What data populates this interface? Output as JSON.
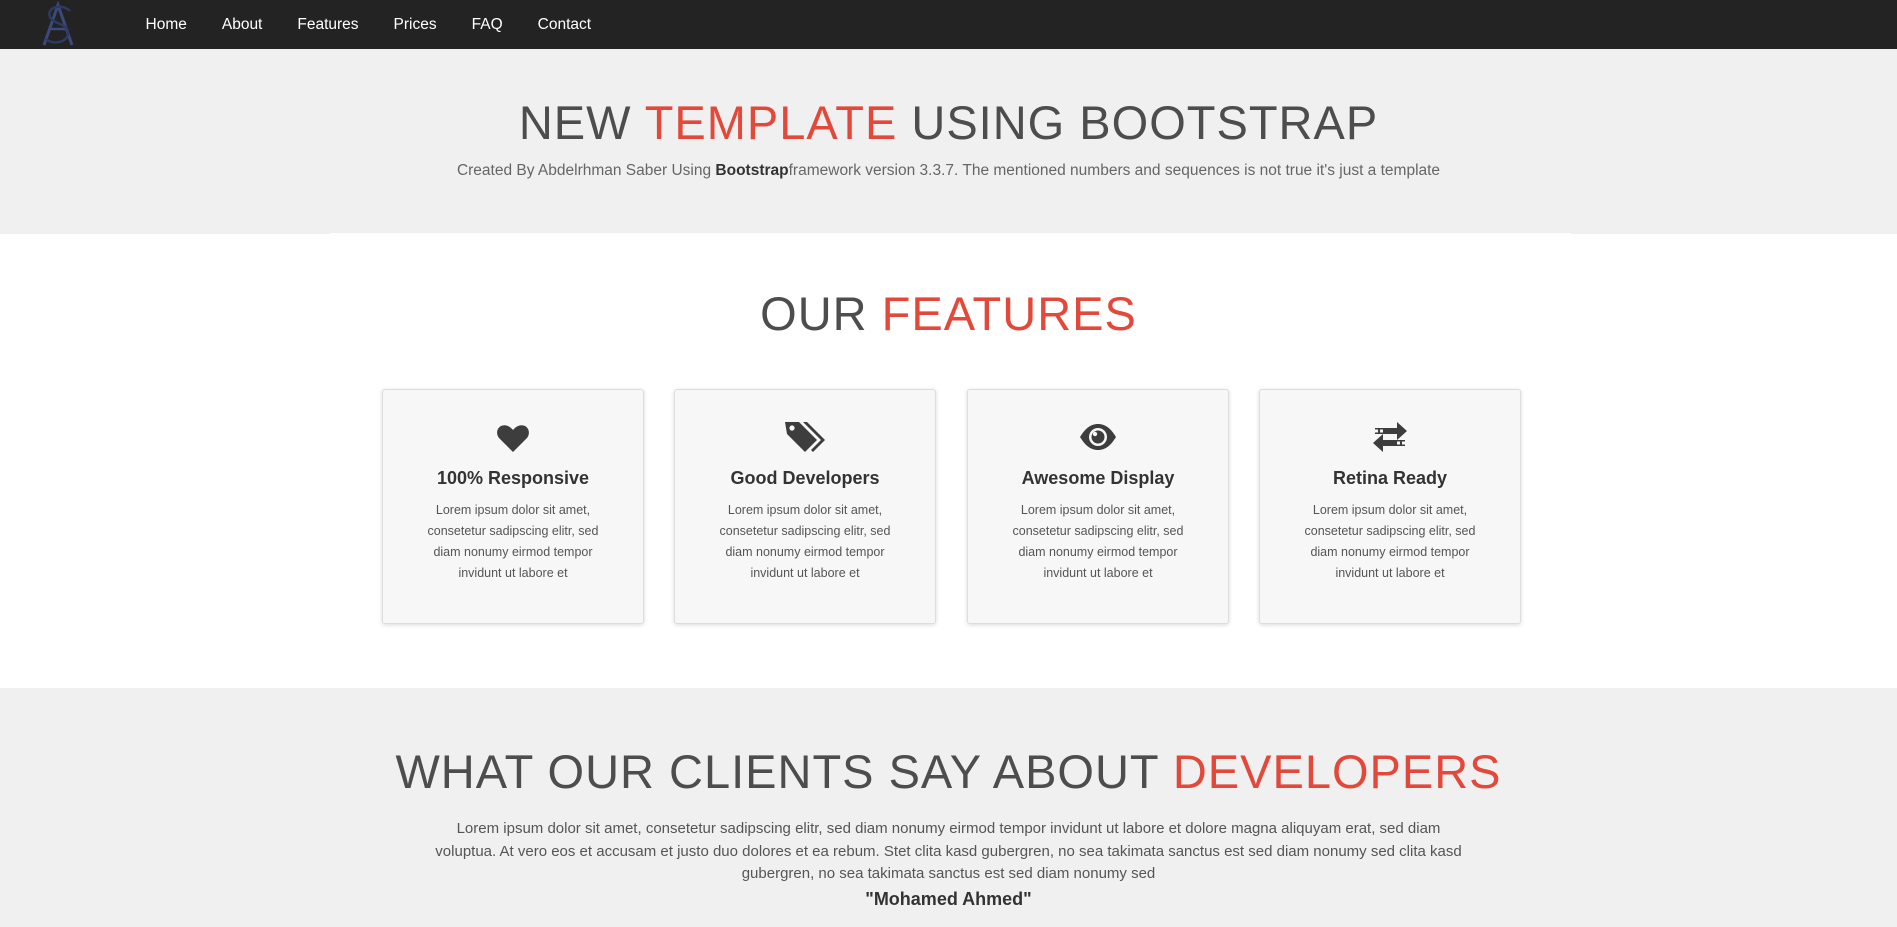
{
  "nav": {
    "logo_alt": "AS logo",
    "links": [
      "Home",
      "About",
      "Features",
      "Prices",
      "FAQ",
      "Contact"
    ]
  },
  "hero": {
    "title_pre": "NEW ",
    "title_accent": "TEMPLATE",
    "title_post": " USING BOOTSTRAP",
    "sub_pre": "Created By Abdelrhman Saber Using ",
    "sub_bold": "Bootstrap",
    "sub_post": "framework version 3.3.7. The mentioned numbers and sequences is not true it's just a template"
  },
  "features": {
    "title_pre": "OUR ",
    "title_accent": "FEATURES",
    "cards": [
      {
        "icon": "heart-icon",
        "title": "100% Responsive",
        "text": "Lorem ipsum dolor sit amet, consetetur sadipscing elitr, sed diam nonumy eirmod tempor invidunt ut labore et"
      },
      {
        "icon": "tags-icon",
        "title": "Good Developers",
        "text": "Lorem ipsum dolor sit amet, consetetur sadipscing elitr, sed diam nonumy eirmod tempor invidunt ut labore et"
      },
      {
        "icon": "eye-icon",
        "title": "Awesome Display",
        "text": "Lorem ipsum dolor sit amet, consetetur sadipscing elitr, sed diam nonumy eirmod tempor invidunt ut labore et"
      },
      {
        "icon": "exchange-arrows-icon",
        "title": "Retina Ready",
        "text": "Lorem ipsum dolor sit amet, consetetur sadipscing elitr, sed diam nonumy eirmod tempor invidunt ut labore et"
      }
    ]
  },
  "clients": {
    "title_pre": "WHAT OUR CLIENTS SAY ABOUT ",
    "title_accent": "DEVELOPERS",
    "text": "Lorem ipsum dolor sit amet, consetetur sadipscing elitr, sed diam nonumy eirmod tempor invidunt ut labore et dolore magna aliquyam erat, sed diam voluptua. At vero eos et accusam et justo duo dolores et ea rebum. Stet clita kasd gubergren, no sea takimata sanctus est sed diam nonumy sed clita kasd gubergren, no sea takimata sanctus est sed diam nonumy sed",
    "author": "\"Mohamed Ahmed\""
  },
  "colors": {
    "navbar": "#232323",
    "accent": "#e2493b",
    "heading": "#4d4d4d",
    "section_bg": "#f0f0f0",
    "card_bg": "#f7f7f7"
  }
}
